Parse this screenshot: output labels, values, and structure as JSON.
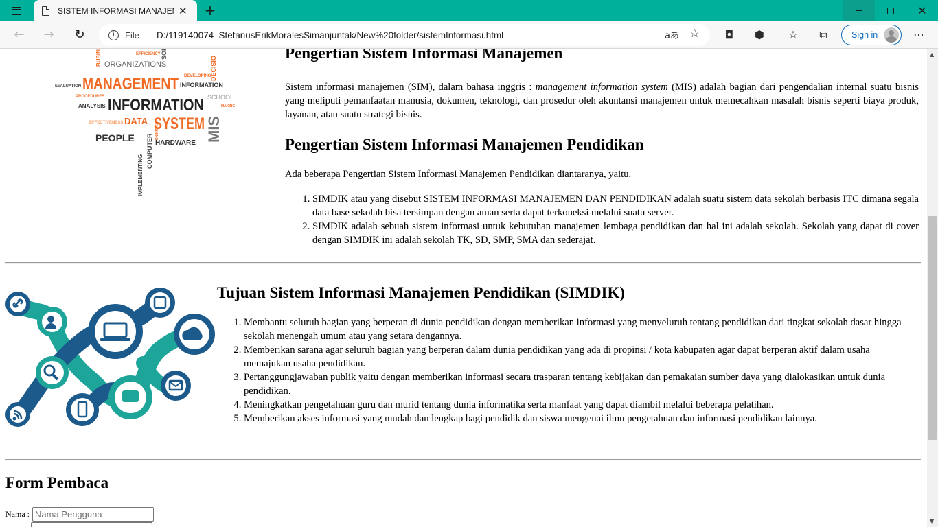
{
  "browser": {
    "tab_title": "SISTEM INFORMASI MANAJEMEN",
    "address_prefix": "File",
    "url": "D:/119140074_StefanusErikMoralesSimanjuntak/New%20folder/sistemInformasi.html",
    "signin_label": "Sign in",
    "accent_color": "#00b09b"
  },
  "section1": {
    "image_words": {
      "management": "MANAGEMENT",
      "information": "INFORMATION",
      "system": "SYSTEM",
      "people": "PEOPLE",
      "hardware": "HARDWARE",
      "organizations": "ORGANIZATIONS",
      "mis": "MIS",
      "decisions": "DECISIO",
      "software": "SOFTW",
      "school": "SCHOOL",
      "evaluation": "EVALUATION",
      "analysis": "ANALYSIS",
      "procedures": "PROCEDURES",
      "data": "DATA",
      "computer": "COMPUTER",
      "implementing": "IMPLEMENTING",
      "efficiency": "EFFICIENCY",
      "developing": "DEVELOPING",
      "information_small": "INFORMATION",
      "effectiveness": "EFFECTIVENESS",
      "making": "MAKING",
      "business": "BUSIN",
      "planning": "PLANNING"
    },
    "heading1": "Pengertian Sistem Informasi Manajemen",
    "para_before": "Sistem informasi manajemen (SIM), dalam bahasa inggris : ",
    "para_italic": "management information system",
    "para_after": " (MIS) adalah bagian dari pengendalian internal suatu bisnis yang meliputi pemanfaatan manusia, dokumen, teknologi, dan prosedur oleh akuntansi manajemen untuk memecahkan masalah bisnis seperti biaya produk, layanan, atau suatu strategi bisnis.",
    "heading2": "Pengertian Sistem Informasi Manajemen Pendidikan",
    "intro": "Ada beberapa Pengertian Sistem Informasi Manajemen Pendidikan diantaranya, yaitu.",
    "items": [
      "SIMDIK atau yang disebut SISTEM INFORMASI MANAJEMEN DAN PENDIDIKAN adalah suatu sistem data sekolah berbasis ITC dimana segala data base sekolah bisa tersimpan dengan aman serta dapat terkoneksi melalui suatu server.",
      "SIMDIK adalah sebuah sistem informasi untuk kebutuhan manajemen lembaga pendidikan dan hal ini adalah sekolah. Sekolah yang dapat di cover dengan SIMDIK ini adalah sekolah TK, SD, SMP, SMA dan sederajat."
    ]
  },
  "section2": {
    "heading": "Tujuan Sistem Informasi Manajemen Pendidikan (SIMDIK)",
    "items": [
      "Membantu seluruh bagian yang berperan di dunia pendidikan dengan memberikan informasi yang menyeluruh tentang pendidikan dari tingkat sekolah dasar hingga sekolah menengah umum atau yang setara dengannya.",
      "Memberikan sarana agar seluruh bagian yang berperan dalam dunia pendidikan yang ada di propinsi / kota kabupaten agar dapat berperan aktif dalam usaha memajukan usaha pendidikan.",
      "Pertanggungjawaban publik yaitu dengan memberikan informasi secara trasparan tentang kebijakan dan pemakaian sumber daya yang dialokasikan untuk dunia pendidikan.",
      "Meningkatkan pengetahuan guru dan murid tentang dunia informatika serta manfaat yang dapat diambil melalui beberapa pelatihan.",
      "Memberikan akses informasi yang mudah dan lengkap bagi pendidik dan siswa mengenai ilmu pengetahuan dan informasi pendidikan lainnya."
    ]
  },
  "form": {
    "title": "Form Pembaca",
    "name_label": "Nama :",
    "name_value": "",
    "name_placeholder": "Nama Pengguna"
  }
}
